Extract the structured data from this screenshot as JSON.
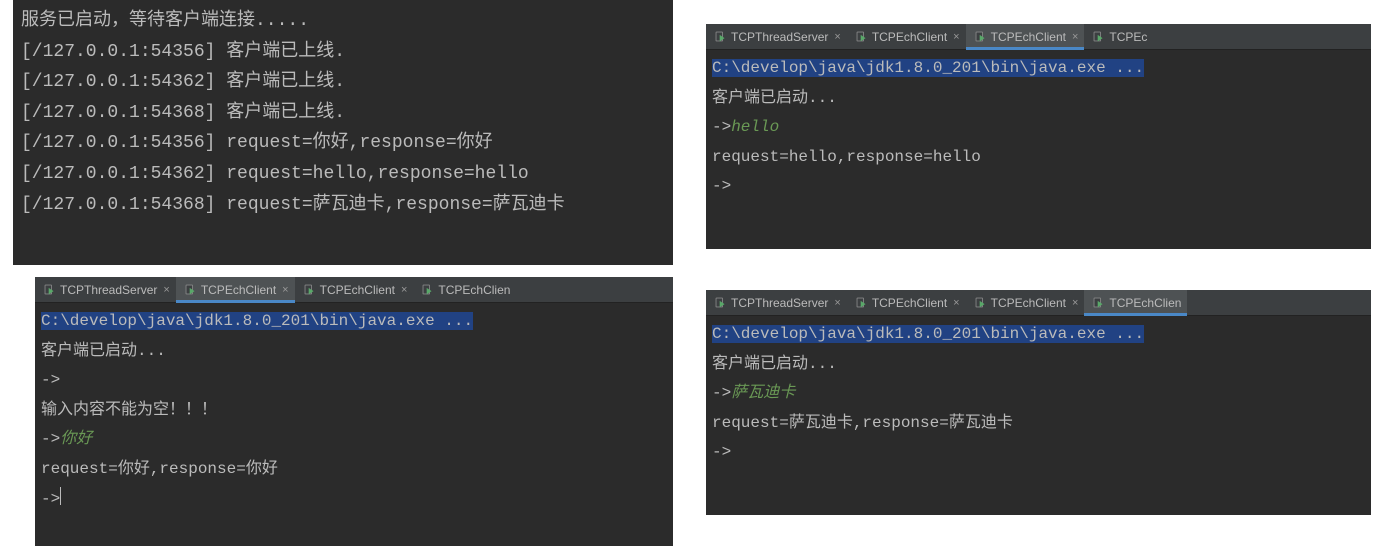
{
  "tabs": {
    "server": "TCPThreadServer",
    "client": "TCPEchClient",
    "client_cut": "TCPEchClien",
    "client_very_cut": "TCPEc"
  },
  "panel1": {
    "l1": "服务已启动，等待客户端连接.....",
    "l2": "[/127.0.0.1:54356] 客户端已上线.",
    "l3": "[/127.0.0.1:54362] 客户端已上线.",
    "l4": "[/127.0.0.1:54368] 客户端已上线.",
    "l5": "[/127.0.0.1:54356] request=你好,response=你好",
    "l6": "[/127.0.0.1:54362] request=hello,response=hello",
    "l7": "[/127.0.0.1:54368] request=萨瓦迪卡,response=萨瓦迪卡"
  },
  "panel2": {
    "cmd": "C:\\develop\\java\\jdk1.8.0_201\\bin\\java.exe ...",
    "l1": "客户端已启动...",
    "l2a": "->",
    "l2b": "hello",
    "l3": "request=hello,response=hello",
    "l4": "->"
  },
  "panel3": {
    "cmd": "C:\\develop\\java\\jdk1.8.0_201\\bin\\java.exe ...",
    "l1": "客户端已启动...",
    "l2": "->",
    "l3": "输入内容不能为空！！！",
    "l4a": "->",
    "l4b": "你好",
    "l5": "request=你好,response=你好",
    "l6": "->"
  },
  "panel4": {
    "cmd": "C:\\develop\\java\\jdk1.8.0_201\\bin\\java.exe ...",
    "l1": "客户端已启动...",
    "l2a": "->",
    "l2b": "萨瓦迪卡",
    "l3": "request=萨瓦迪卡,response=萨瓦迪卡",
    "l4": "->"
  }
}
